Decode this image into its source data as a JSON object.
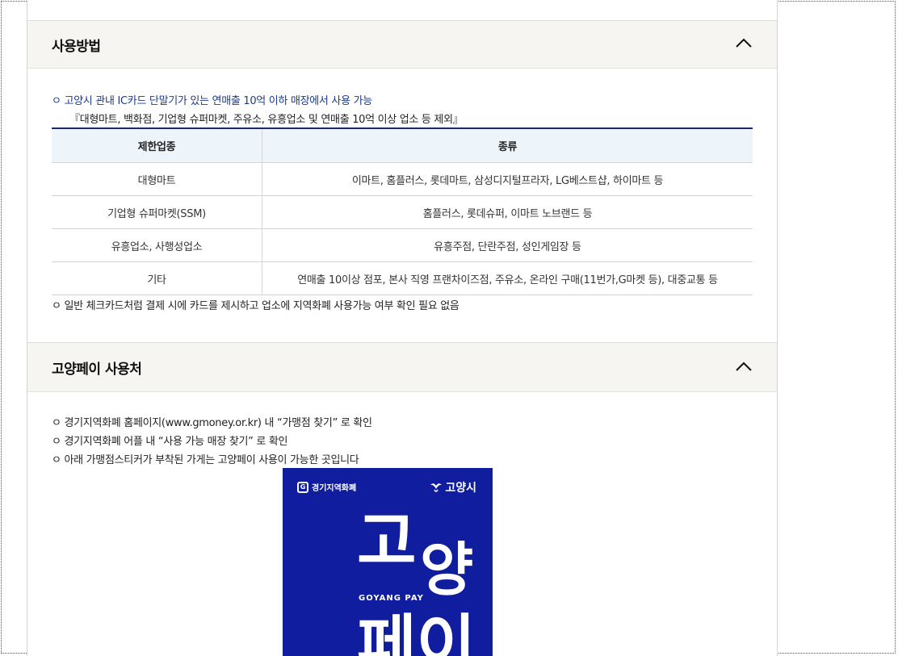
{
  "sections": [
    {
      "title": "사용방법",
      "lines": [
        "ㅇ 고양시 관내 IC카드 단말기가 있는 연매출 10억 이하 매장에서 사용 가능",
        "『대형마트, 백화점, 기업형 슈퍼마켓, 주유소, 유흥업소 및 연매출 10억 이상 업소 등 제외』"
      ],
      "table": {
        "headers": [
          "제한업종",
          "종류"
        ],
        "rows": [
          [
            "대형마트",
            "이마트, 홈플러스, 롯데마트, 삼성디지털프라자, LG베스트샵, 하이마트 등"
          ],
          [
            "기업형 슈퍼마켓(SSM)",
            "홈플러스, 롯데슈퍼, 이마트 노브랜드 등"
          ],
          [
            "유흥업소, 사행성업소",
            "유흥주점, 단란주점, 성인게임장 등"
          ],
          [
            "기타",
            "연매출 10이상 점포, 본사 직영 프랜차이즈점, 주유소, 온라인 구매(11번가,G마켓 등), 대중교통 등"
          ]
        ]
      },
      "note": "ㅇ 일반 체크카드처럼 결제 시에 카드를 제시하고 업소에 지역화폐 사용가능 여부 확인 필요 없음"
    },
    {
      "title": "고양페이 사용처",
      "lines": [
        "ㅇ 경기지역화폐 홈페이지(www.gmoney.or.kr) 내 “가맹점 찾기” 로 확인",
        "ㅇ 경기지역화폐 어플 내 “사용 가능 매장 찾기” 로 확인",
        "ㅇ 아래 가맹점스티커가 부착된 가게는 고양페이 사용이 가능한 곳입니다"
      ]
    }
  ],
  "poster": {
    "logo_left": "경기지역화폐",
    "logo_left_badge": "G",
    "logo_right": "고양시",
    "big_1": "고",
    "big_2": "양",
    "big_3": "페이",
    "sub": "GOYANG PAY",
    "bg_color": "#0f1d9e"
  }
}
